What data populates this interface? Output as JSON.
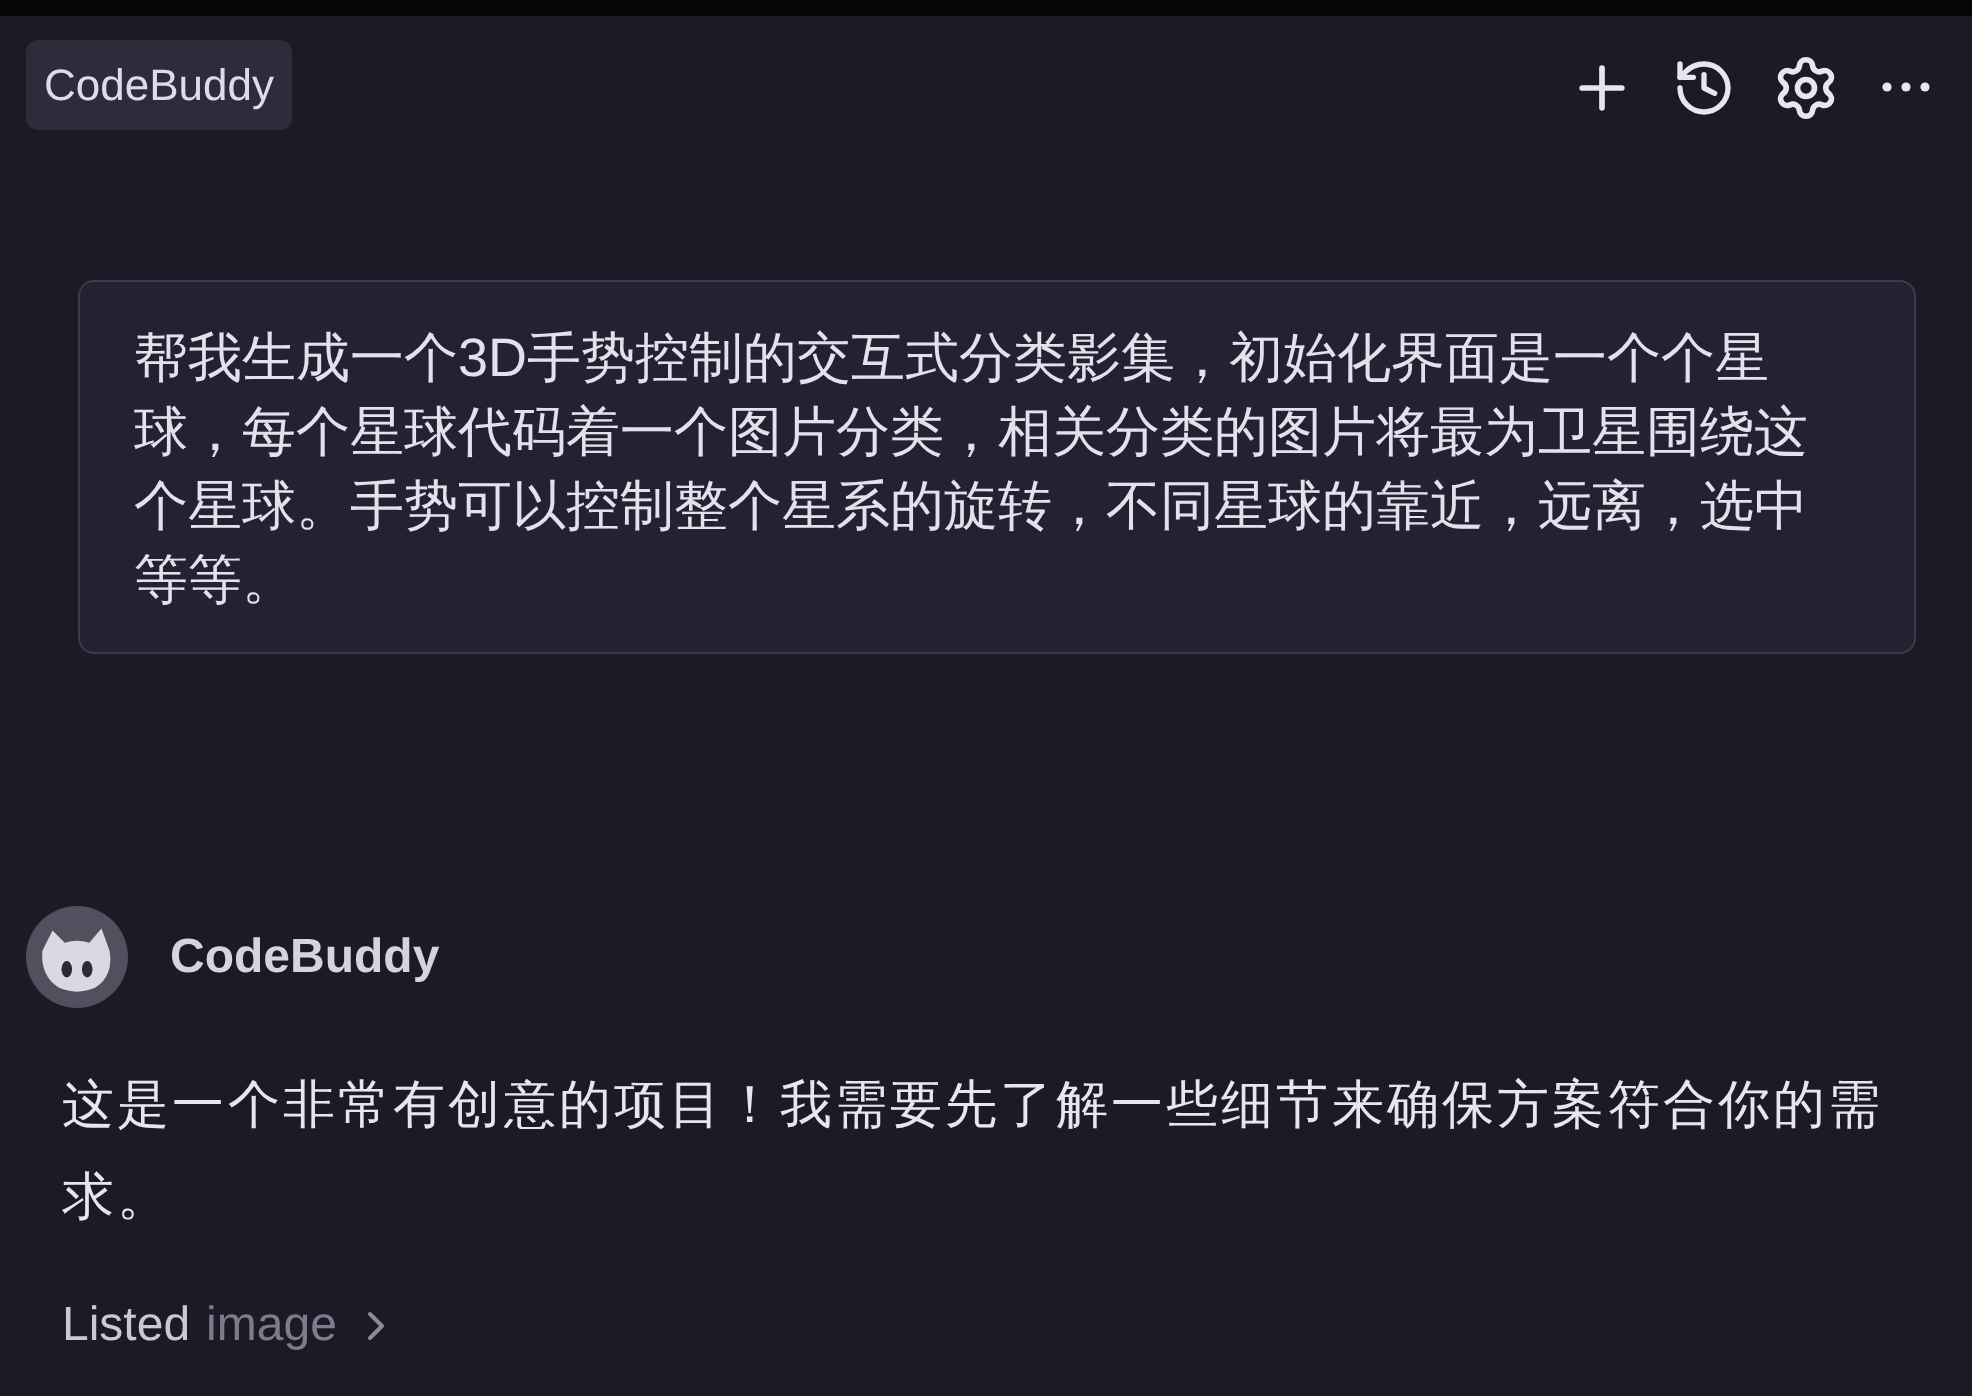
{
  "header": {
    "title": "CodeBuddy"
  },
  "user_message": {
    "text": "帮我生成一个3D手势控制的交互式分类影集，初始化界面是一个个星球，每个星球代码着一个图片分类，相关分类的图片将最为卫星围绕这个星球。手势可以控制整个星系的旋转，不同星球的靠近，远离，选中等等。"
  },
  "assistant_message": {
    "name": "CodeBuddy",
    "text": "这是一个非常有创意的项目！我需要先了解一些细节来确保方案符合你的需求。",
    "steps": [
      {
        "action": "Listed",
        "target": "image",
        "expanded": false
      }
    ]
  }
}
